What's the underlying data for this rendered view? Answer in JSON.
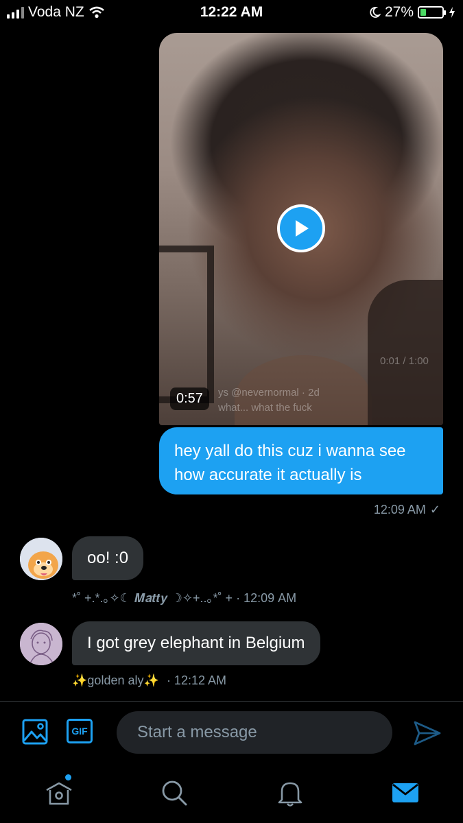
{
  "status_bar": {
    "carrier": "Voda NZ",
    "time": "12:22 AM",
    "battery_percent": "27%",
    "battery_level": 0.27
  },
  "media": {
    "duration": "0:57",
    "ghost_time": "0:01 / 1:00",
    "ghost_user": "ys @nevernormal · 2d",
    "ghost_text": "what... what the fuck"
  },
  "outgoing": {
    "text": "hey yall do this cuz i wanna see how accurate it actually is",
    "time": "12:09 AM",
    "read_icon": "checkmark"
  },
  "incoming": [
    {
      "text": "oo! :0",
      "sender": "*˚ +.*.｡✧☾ 𝑴𝒂𝒕𝒕𝒚 ☽✧+..｡*˚ +",
      "time": "· 12:09 AM"
    },
    {
      "text": "I got grey elephant in Belgium",
      "sender_prefix": "✨",
      "sender": "golden aly",
      "sender_suffix": "✨",
      "time": "· 12:12 AM"
    }
  ],
  "composer": {
    "gif_label": "GIF",
    "placeholder": "Start a message"
  },
  "tabs": [
    "home-icon",
    "search-icon",
    "notifications-icon",
    "messages-icon"
  ],
  "colors": {
    "accent": "#1da1f2",
    "bubble_in": "#2f3336",
    "meta": "#8899a6"
  }
}
